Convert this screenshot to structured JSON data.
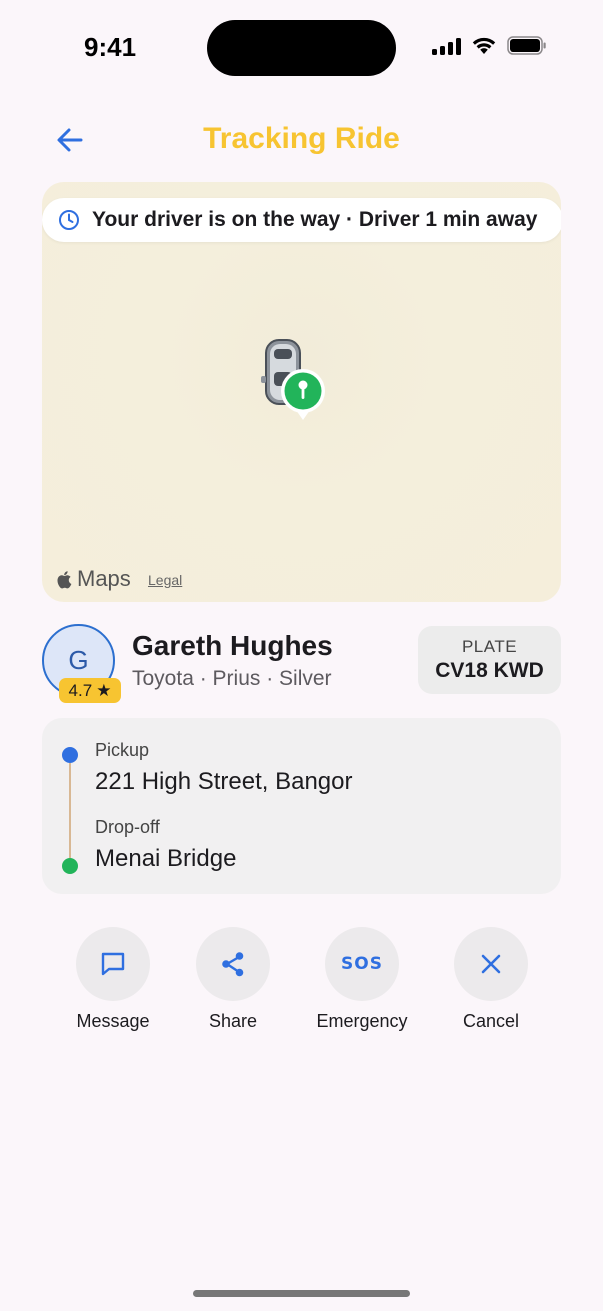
{
  "status_bar": {
    "time": "9:41"
  },
  "header": {
    "title": "Tracking Ride"
  },
  "map": {
    "eta_message": "Your driver is on the way · Driver 1 min away",
    "maps_brand": "Maps",
    "legal_link": "Legal"
  },
  "driver": {
    "initial": "G",
    "rating": "4.7",
    "rating_star": "★",
    "name": "Gareth Hughes",
    "vehicle": "Toyota · Prius · Silver",
    "plate_label": "PLATE",
    "plate_value": "CV18 KWD"
  },
  "route": {
    "pickup_label": "Pickup",
    "pickup_address": "221 High Street, Bangor",
    "dropoff_label": "Drop-off",
    "dropoff_address": "Menai Bridge"
  },
  "actions": [
    {
      "label": "Message",
      "icon": "message-icon"
    },
    {
      "label": "Share",
      "icon": "share-icon"
    },
    {
      "label": "Emergency",
      "icon": "sos-icon",
      "icon_text": "SOS"
    },
    {
      "label": "Cancel",
      "icon": "close-icon"
    }
  ],
  "colors": {
    "accent_yellow": "#f7c431",
    "accent_blue": "#2f6fe0",
    "pickup_dot": "#2f6fe0",
    "dropoff_dot": "#22b45a",
    "background": "#fbf6fa"
  }
}
